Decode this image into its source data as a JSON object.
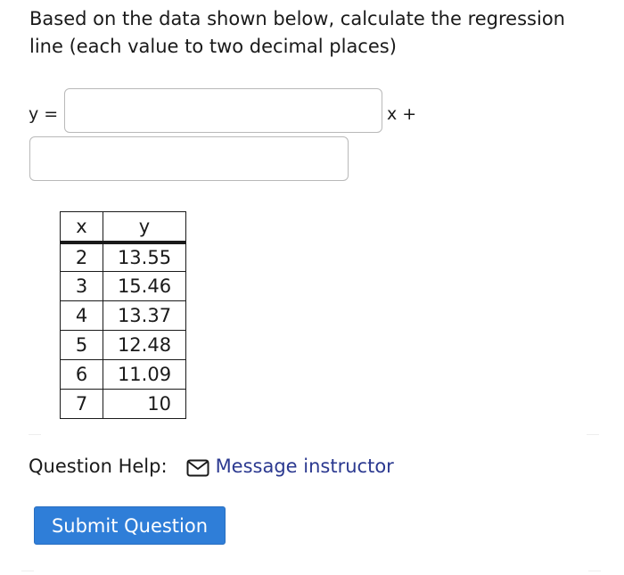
{
  "question": {
    "text": "Based on the data shown below, calculate the regression line (each value to two decimal places)"
  },
  "equation": {
    "prefix": "y =",
    "suffix": "x +",
    "slope_value": "",
    "intercept_value": ""
  },
  "table": {
    "headers": [
      "x",
      "y"
    ],
    "rows": [
      [
        "2",
        "13.55"
      ],
      [
        "3",
        "15.46"
      ],
      [
        "4",
        "13.37"
      ],
      [
        "5",
        "12.48"
      ],
      [
        "6",
        "11.09"
      ],
      [
        "7",
        "10"
      ]
    ]
  },
  "help": {
    "label": "Question Help:",
    "icon": "mail-icon",
    "link_text": "Message instructor",
    "link_color": "#2b3990"
  },
  "submit": {
    "label": "Submit Question",
    "color": "#2f7ed8"
  }
}
